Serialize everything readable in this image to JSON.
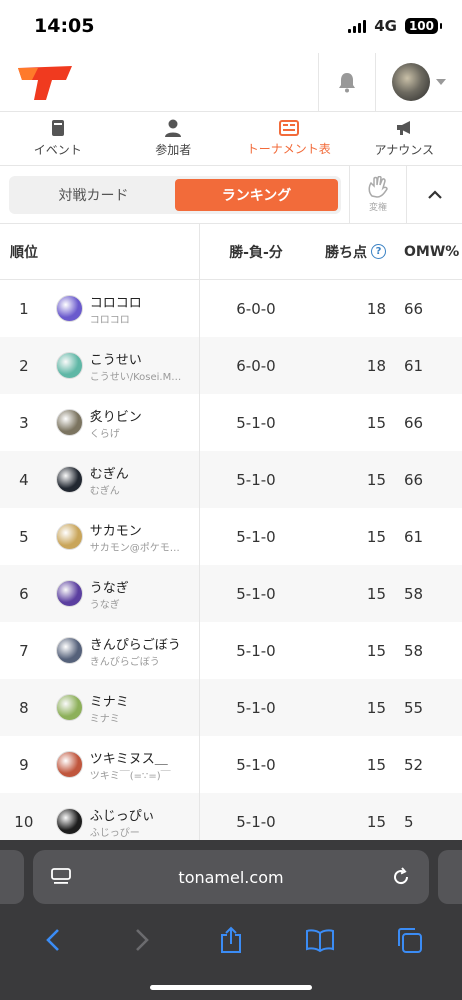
{
  "status": {
    "time": "14:05",
    "network": "4G",
    "battery": "100"
  },
  "nav_tabs": [
    {
      "label": "イベント"
    },
    {
      "label": "参加者"
    },
    {
      "label": "トーナメント表"
    },
    {
      "label": "アナウンス"
    }
  ],
  "segments": {
    "matchcards": "対戦カード",
    "ranking": "ランキング"
  },
  "cheer_label": "変権",
  "table": {
    "headers": {
      "rank": "順位",
      "record": "勝-負-分",
      "points": "勝ち点",
      "omw": "OMW%"
    },
    "rows": [
      {
        "rank": "1",
        "name": "コロコロ",
        "sub": "コロコロ",
        "record": "6-0-0",
        "points": "18",
        "omw": "66",
        "avatar_color": "#6a5acd"
      },
      {
        "rank": "2",
        "name": "こうせい",
        "sub": "こうせい/Kosei.M…",
        "record": "6-0-0",
        "points": "18",
        "omw": "61",
        "avatar_color": "#5fb7a6"
      },
      {
        "rank": "3",
        "name": "炙りビン",
        "sub": "くらげ",
        "record": "5-1-0",
        "points": "15",
        "omw": "66",
        "avatar_color": "#7b7460"
      },
      {
        "rank": "4",
        "name": "むぎん",
        "sub": "むぎん",
        "record": "5-1-0",
        "points": "15",
        "omw": "66",
        "avatar_color": "#222831"
      },
      {
        "rank": "5",
        "name": "サカモン",
        "sub": "サカモン@ポケモ…",
        "record": "5-1-0",
        "points": "15",
        "omw": "61",
        "avatar_color": "#c9a55a"
      },
      {
        "rank": "6",
        "name": "うなぎ",
        "sub": "うなぎ",
        "record": "5-1-0",
        "points": "15",
        "omw": "58",
        "avatar_color": "#5b3fa0"
      },
      {
        "rank": "7",
        "name": "きんぴらごぼう",
        "sub": "きんぴらごぼう",
        "record": "5-1-0",
        "points": "15",
        "omw": "58",
        "avatar_color": "#55617a"
      },
      {
        "rank": "8",
        "name": "ミナミ",
        "sub": "ミナミ",
        "record": "5-1-0",
        "points": "15",
        "omw": "55",
        "avatar_color": "#8db05a"
      },
      {
        "rank": "9",
        "name": "ツキミヌス＿",
        "sub": "ツキミ￣(=∵=)￣",
        "record": "5-1-0",
        "points": "15",
        "omw": "52",
        "avatar_color": "#c0563d"
      },
      {
        "rank": "10",
        "name": "ふじっぴぃ",
        "sub": "ふじっぴー",
        "record": "5-1-0",
        "points": "15",
        "omw": "5",
        "avatar_color": "#1e1e1e"
      }
    ]
  },
  "browser": {
    "url": "tonamel.com"
  },
  "colors": {
    "accent": "#f26b3a",
    "ios_blue": "#3b8cf5"
  }
}
